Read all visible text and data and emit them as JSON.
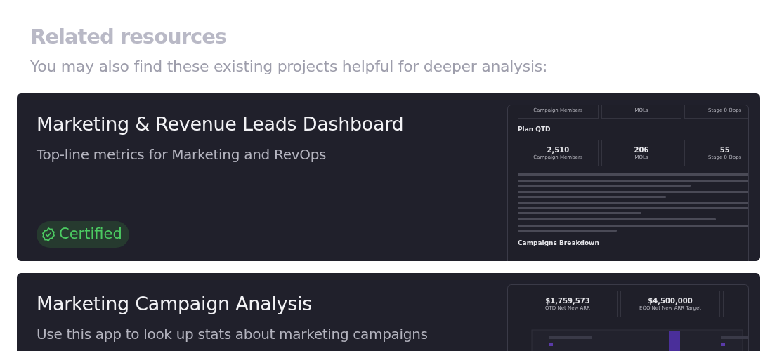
{
  "heading": "Related resources",
  "subheading": "You may also find these existing projects helpful for deeper analysis:",
  "resources": [
    {
      "title": "Marketing & Revenue Leads Dashboard",
      "description": "Top-line metrics for Marketing and RevOps",
      "certified": true,
      "badge": "Certified",
      "preview": [
        {
          "kind": "stats-cut",
          "stats": [
            {
              "label": "Campaign Members"
            },
            {
              "label": "MQLs"
            },
            {
              "label": "Stage 0 Opps"
            }
          ]
        },
        {
          "kind": "heading",
          "text": "Plan QTD"
        },
        {
          "kind": "stats",
          "stats": [
            {
              "value": "2,510",
              "label": "Campaign Members"
            },
            {
              "value": "206",
              "label": "MQLs"
            },
            {
              "value": "55",
              "label": "Stage 0 Opps"
            }
          ]
        },
        {
          "kind": "text-block"
        },
        {
          "kind": "heading",
          "text": "Campaigns Breakdown"
        }
      ]
    },
    {
      "title": "Marketing Campaign Analysis",
      "description": "Use this app to look up stats about marketing campaigns",
      "preview": [
        {
          "kind": "stats",
          "more": true,
          "stats": [
            {
              "value": "$1,759,573",
              "label": "QTD Net New ARR"
            },
            {
              "value": "$4,500,000",
              "label": "EOQ Net New ARR Target"
            }
          ]
        },
        {
          "kind": "chart-picture"
        }
      ]
    }
  ]
}
